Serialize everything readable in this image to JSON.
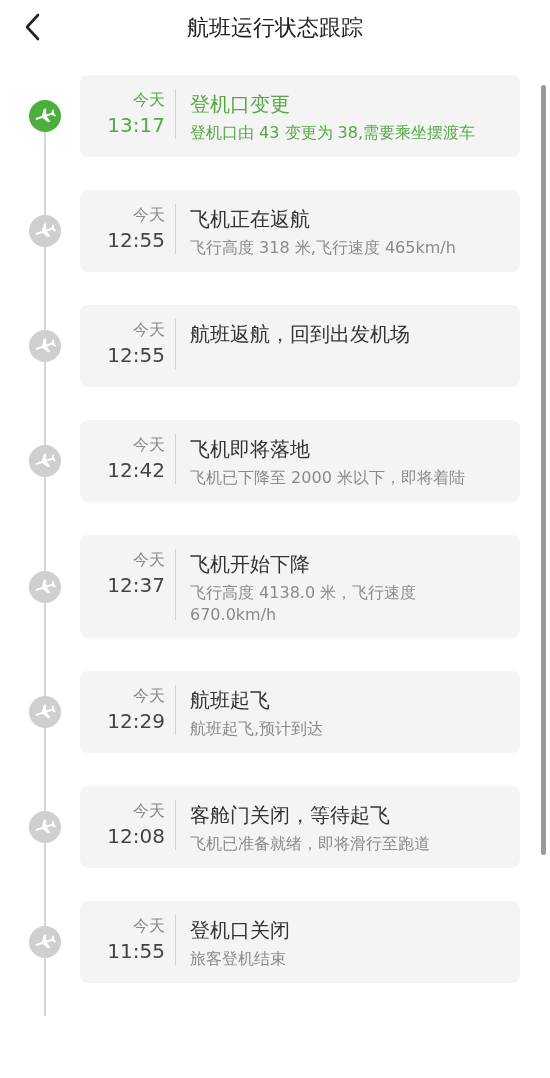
{
  "header": {
    "title": "航班运行状态跟踪"
  },
  "events": [
    {
      "day": "今天",
      "time": "13:17",
      "title": "登机口变更",
      "detail": "登机口由 43 变更为 38,需要乘坐摆渡车",
      "current": true
    },
    {
      "day": "今天",
      "time": "12:55",
      "title": "飞机正在返航",
      "detail": "飞行高度 318 米,飞行速度 465km/h",
      "current": false
    },
    {
      "day": "今天",
      "time": "12:55",
      "title": "航班返航，回到出发机场",
      "current": false
    },
    {
      "day": "今天",
      "time": "12:42",
      "title": "飞机即将落地",
      "detail": "飞机已下降至 2000 米以下，即将着陆",
      "current": false
    },
    {
      "day": "今天",
      "time": "12:37",
      "title": "飞机开始下降",
      "detail": "飞行高度 4138.0 米，飞行速度 670.0km/h",
      "current": false
    },
    {
      "day": "今天",
      "time": "12:29",
      "title": "航班起飞",
      "detail": "航班起飞,预计到达",
      "current": false
    },
    {
      "day": "今天",
      "time": "12:08",
      "title": "客舱门关闭，等待起飞",
      "detail": "飞机已准备就绪，即将滑行至跑道",
      "current": false
    },
    {
      "day": "今天",
      "time": "11:55",
      "title": "登机口关闭",
      "detail": "旅客登机结束",
      "current": false
    }
  ]
}
